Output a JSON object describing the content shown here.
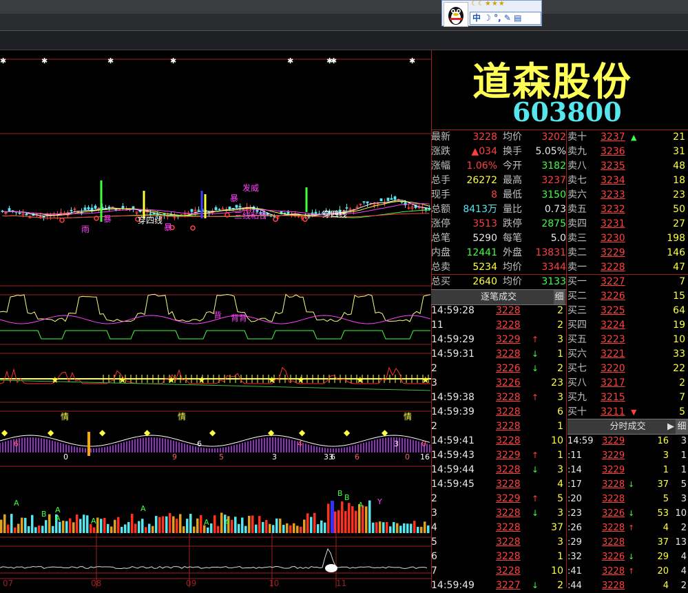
{
  "window": {
    "qq_toolbar": "中 ☽ °, ✎ ▤",
    "qq_stars": "☾☾★★★"
  },
  "stock": {
    "name": "道森股份",
    "code": "603800"
  },
  "quote": [
    {
      "l1": "最新",
      "v1": "3228",
      "c1": "red",
      "l2": "均价",
      "v2": "3202",
      "c2": "red"
    },
    {
      "l1": "涨跌",
      "v1": "▲034",
      "c1": "red",
      "l2": "换手",
      "v2": "5.05%",
      "c2": "white"
    },
    {
      "l1": "涨幅",
      "v1": "1.06%",
      "c1": "red",
      "l2": "今开",
      "v2": "3182",
      "c2": "green"
    },
    {
      "l1": "总手",
      "v1": "26272",
      "c1": "yellow",
      "l2": "最高",
      "v2": "3237",
      "c2": "red"
    },
    {
      "l1": "现手",
      "v1": "8",
      "c1": "red",
      "l2": "最低",
      "v2": "3150",
      "c2": "green"
    },
    {
      "l1": "总额",
      "v1": "8413万",
      "c1": "cyan",
      "l2": "量比",
      "v2": "0.73",
      "c2": "white"
    },
    {
      "l1": "涨停",
      "v1": "3513",
      "c1": "red",
      "l2": "跌停",
      "v2": "2875",
      "c2": "green"
    },
    {
      "l1": "总笔",
      "v1": "5290",
      "c1": "white",
      "l2": "每笔",
      "v2": "5.0",
      "c2": "white"
    },
    {
      "l1": "内盘",
      "v1": "12441",
      "c1": "green",
      "l2": "外盘",
      "v2": "13831",
      "c2": "red"
    },
    {
      "l1": "总卖",
      "v1": "5234",
      "c1": "yellow",
      "l2": "均价",
      "v2": "3344",
      "c2": "red"
    },
    {
      "l1": "总买",
      "v1": "2640",
      "c1": "yellow",
      "l2": "均价",
      "v2": "3133",
      "c2": "green"
    }
  ],
  "book": [
    {
      "l": "卖十",
      "p": "3237",
      "a": "▲",
      "ac": "green",
      "v": "21"
    },
    {
      "l": "卖九",
      "p": "3236",
      "a": "",
      "ac": "",
      "v": "31"
    },
    {
      "l": "卖八",
      "p": "3235",
      "a": "",
      "ac": "",
      "v": "48"
    },
    {
      "l": "卖七",
      "p": "3234",
      "a": "",
      "ac": "",
      "v": "18"
    },
    {
      "l": "卖六",
      "p": "3233",
      "a": "",
      "ac": "",
      "v": "23"
    },
    {
      "l": "卖五",
      "p": "3232",
      "a": "",
      "ac": "",
      "v": "50"
    },
    {
      "l": "卖四",
      "p": "3231",
      "a": "",
      "ac": "",
      "v": "27"
    },
    {
      "l": "卖三",
      "p": "3230",
      "a": "",
      "ac": "",
      "v": "198"
    },
    {
      "l": "卖二",
      "p": "3229",
      "a": "",
      "ac": "",
      "v": "146"
    },
    {
      "l": "卖一",
      "p": "3228",
      "a": "",
      "ac": "",
      "v": "47"
    },
    {
      "l": "买一",
      "p": "3227",
      "a": "",
      "ac": "",
      "v": "7"
    },
    {
      "l": "买二",
      "p": "3226",
      "a": "",
      "ac": "",
      "v": "15"
    },
    {
      "l": "买三",
      "p": "3225",
      "a": "",
      "ac": "",
      "v": "64"
    },
    {
      "l": "买四",
      "p": "3224",
      "a": "",
      "ac": "",
      "v": "19"
    },
    {
      "l": "买五",
      "p": "3223",
      "a": "",
      "ac": "",
      "v": "10"
    },
    {
      "l": "买六",
      "p": "3221",
      "a": "",
      "ac": "",
      "v": "33"
    },
    {
      "l": "买七",
      "p": "3220",
      "a": "",
      "ac": "",
      "v": "22"
    },
    {
      "l": "买八",
      "p": "3217",
      "a": "",
      "ac": "",
      "v": "2"
    },
    {
      "l": "买九",
      "p": "3215",
      "a": "",
      "ac": "",
      "v": "7"
    },
    {
      "l": "买十",
      "p": "3211",
      "a": "▼",
      "ac": "red",
      "v": "5"
    }
  ],
  "tick_header": {
    "title": "逐笔成交",
    "detail": "细"
  },
  "ticks": [
    {
      "t": "14:59:28",
      "p": "3228",
      "a": "",
      "v": "2"
    },
    {
      "t": "11",
      "p": "3228",
      "a": "",
      "v": "2"
    },
    {
      "t": "14:59:29",
      "p": "3229",
      "a": "up",
      "v": "3"
    },
    {
      "t": "14:59:31",
      "p": "3228",
      "a": "down",
      "v": "1"
    },
    {
      "t": "2",
      "p": "3226",
      "a": "down",
      "v": "2"
    },
    {
      "t": "3",
      "p": "3226",
      "a": "",
      "v": "23"
    },
    {
      "t": "14:59:38",
      "p": "3228",
      "a": "up",
      "v": "3"
    },
    {
      "t": "14:59:39",
      "p": "3228",
      "a": "",
      "v": "6"
    },
    {
      "t": "2",
      "p": "3228",
      "a": "",
      "v": "1"
    },
    {
      "t": "14:59:41",
      "p": "3228",
      "a": "",
      "v": "10"
    },
    {
      "t": "14:59:43",
      "p": "3229",
      "a": "up",
      "v": "1"
    },
    {
      "t": "14:59:44",
      "p": "3228",
      "a": "down",
      "v": "3"
    },
    {
      "t": "14:59:45",
      "p": "3228",
      "a": "",
      "v": "4"
    },
    {
      "t": "2",
      "p": "3229",
      "a": "up",
      "v": "5"
    },
    {
      "t": "3",
      "p": "3228",
      "a": "down",
      "v": "3"
    },
    {
      "t": "4",
      "p": "3228",
      "a": "",
      "v": "37"
    },
    {
      "t": "5",
      "p": "3228",
      "a": "",
      "v": "3"
    },
    {
      "t": "6",
      "p": "3228",
      "a": "",
      "v": "1"
    },
    {
      "t": "7",
      "p": "3228",
      "a": "",
      "v": "10"
    },
    {
      "t": "14:59:49",
      "p": "3227",
      "a": "down",
      "v": "2"
    }
  ],
  "minute_header": {
    "title": "分时成交",
    "detail": "细"
  },
  "minute_ticks": [
    {
      "t": "14:59",
      "p": "3229",
      "a": "",
      "v": "16",
      "c": "3"
    },
    {
      "t": ":11",
      "p": "3229",
      "a": "",
      "v": "3",
      "c": "1"
    },
    {
      "t": ":14",
      "p": "3229",
      "a": "",
      "v": "1",
      "c": "1"
    },
    {
      "t": ":17",
      "p": "3228",
      "a": "down",
      "v": "37",
      "c": "5"
    },
    {
      "t": ":20",
      "p": "3228",
      "a": "",
      "v": "5",
      "c": "3"
    },
    {
      "t": ":23",
      "p": "3226",
      "a": "down",
      "v": "53",
      "c": "10"
    },
    {
      "t": ":26",
      "p": "3228",
      "a": "up",
      "v": "4",
      "c": "2"
    },
    {
      "t": ":29",
      "p": "3228",
      "a": "",
      "v": "37",
      "c": "13"
    },
    {
      "t": ":32",
      "p": "3226",
      "a": "down",
      "v": "29",
      "c": "4"
    },
    {
      "t": ":41",
      "p": "3228",
      "a": "up",
      "v": "20",
      "c": "4"
    },
    {
      "t": ":44",
      "p": "3228",
      "a": "",
      "v": "4",
      "c": "2"
    }
  ],
  "chart_labels": {
    "x_ticks": [
      "07",
      "08",
      "09",
      "10",
      "11"
    ],
    "annotations": [
      "发威",
      "暴",
      "三线粘合",
      "穿四线",
      "穿四线",
      "雨",
      "暴",
      "暴",
      "背",
      "背背",
      "情",
      "情",
      "情"
    ],
    "markers": [
      "A",
      "A",
      "A",
      "A",
      "A",
      "A",
      "A",
      "B",
      "B",
      "B",
      "A",
      "Y",
      "Y",
      "Y"
    ],
    "nums": [
      "6",
      "0",
      "9",
      "6",
      "5",
      "3",
      "4",
      "33",
      "6",
      "3",
      "0",
      "16",
      "0",
      "6"
    ]
  },
  "colors": {
    "up": "#ff4040",
    "down": "#40ff40",
    "grid": "#a02020",
    "text_yellow": "#ffff40",
    "name": "#ffff55",
    "code": "#55e6ee"
  }
}
